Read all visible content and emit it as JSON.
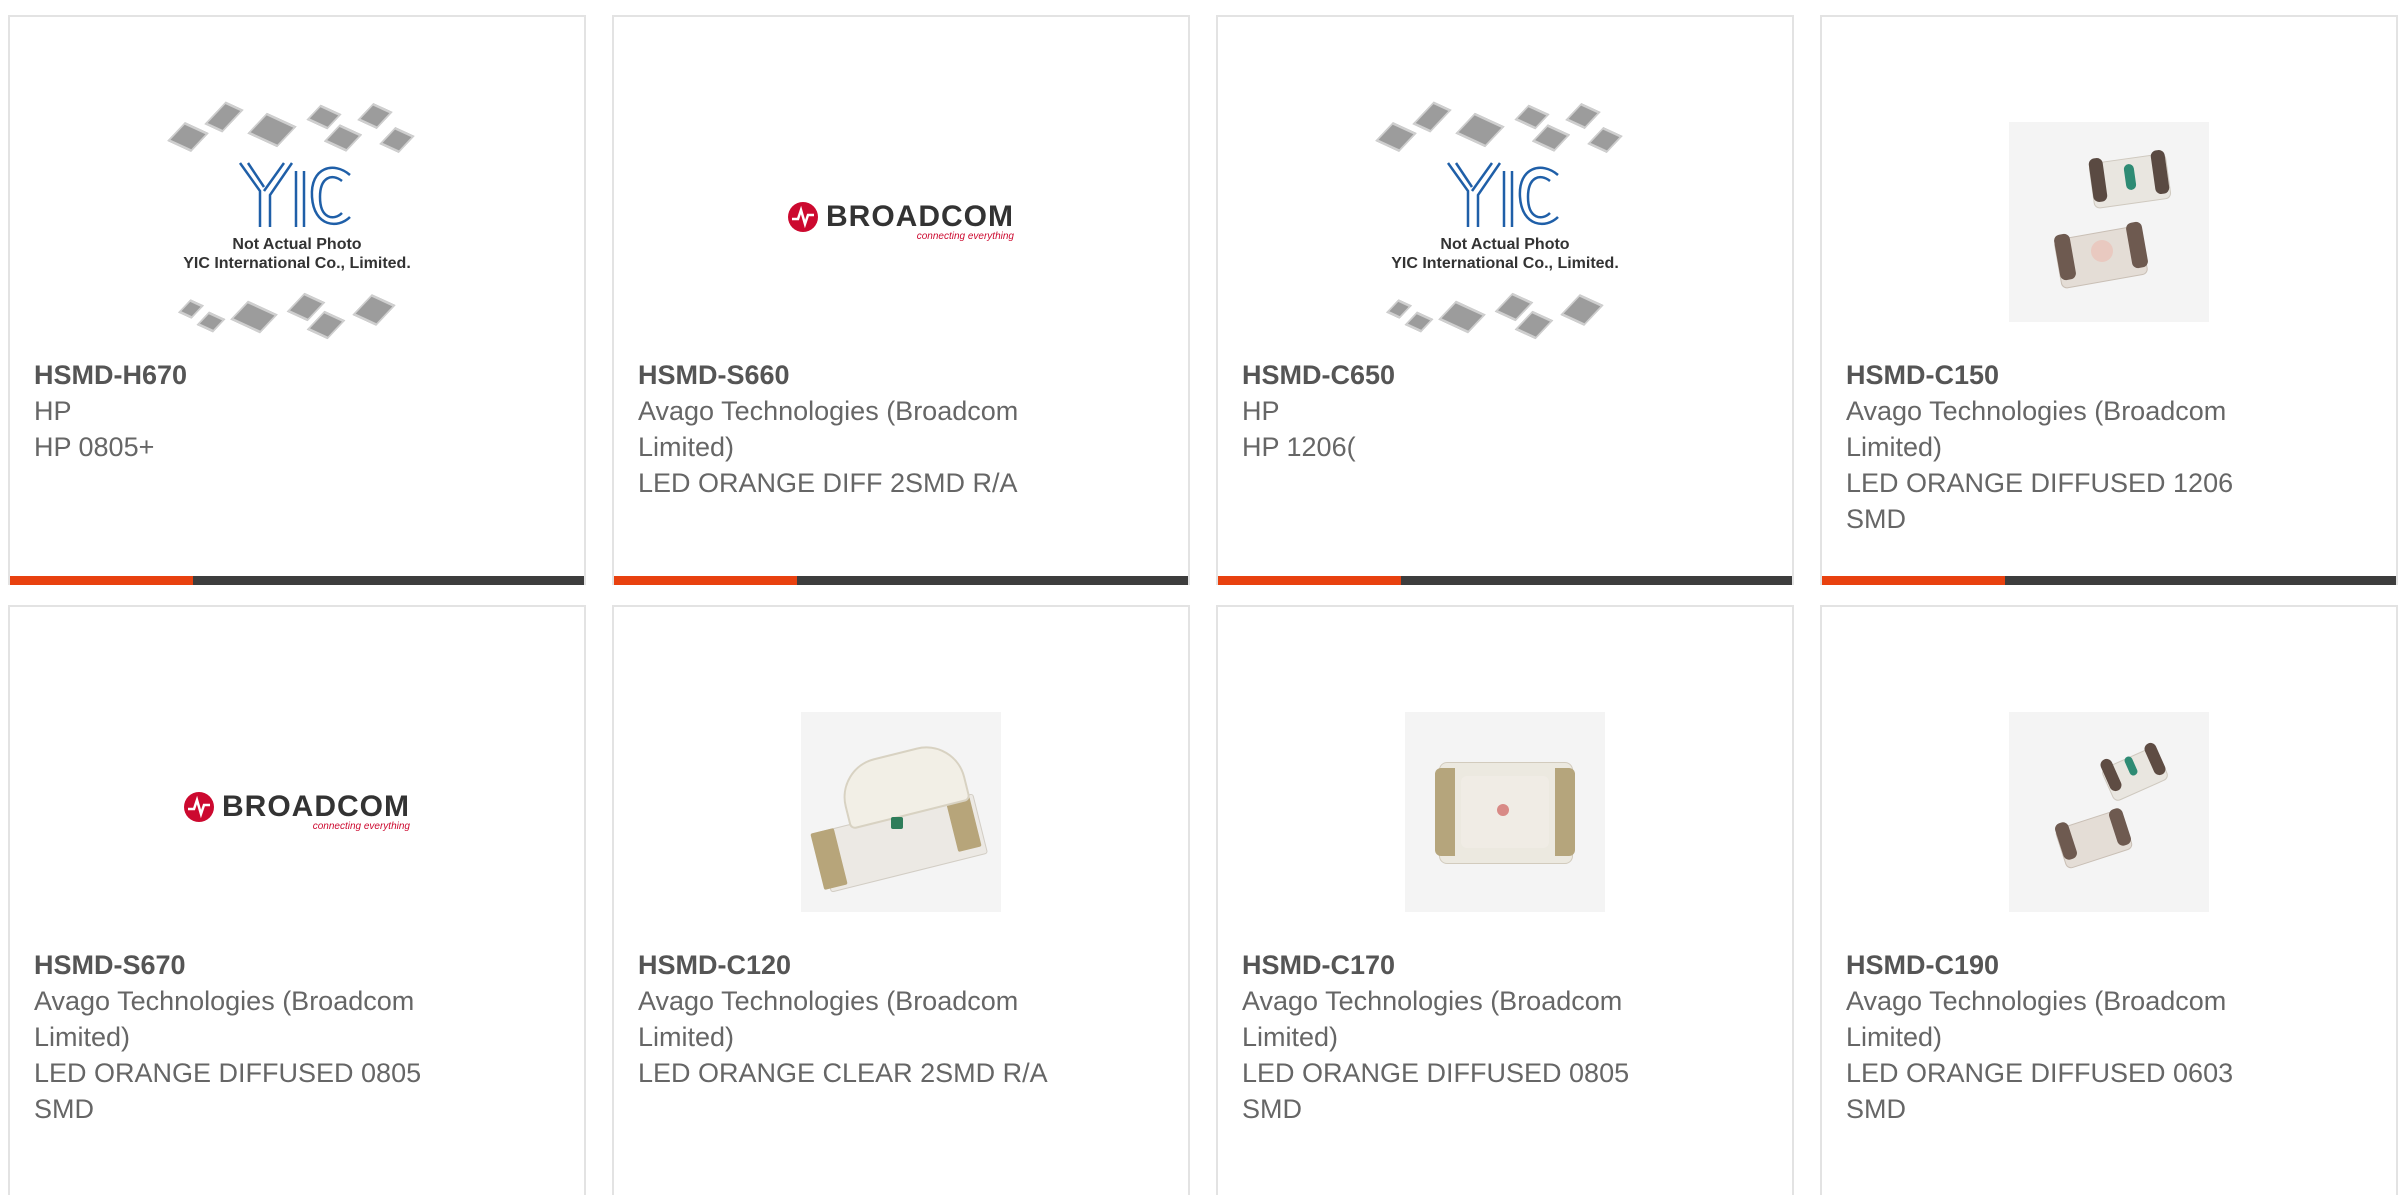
{
  "products": [
    {
      "part": "HSMD-H670",
      "manufacturer": "HP",
      "description": "HP 0805+",
      "image": "yic-placeholder",
      "placeholder_line1": "Not Actual Photo",
      "placeholder_line2": "YIC International Co., Limited."
    },
    {
      "part": "HSMD-S660",
      "manufacturer": "Avago Technologies (Broadcom Limited)",
      "description": "LED ORANGE DIFF 2SMD R/A",
      "image": "broadcom-logo",
      "logo_word": "BROADCOM",
      "logo_tag": "connecting everything"
    },
    {
      "part": "HSMD-C650",
      "manufacturer": "HP",
      "description": "HP 1206(",
      "image": "yic-placeholder",
      "placeholder_line1": "Not Actual Photo",
      "placeholder_line2": "YIC International Co., Limited."
    },
    {
      "part": "HSMD-C150",
      "manufacturer": "Avago Technologies (Broadcom Limited)",
      "description": "LED ORANGE DIFFUSED 1206 SMD",
      "image": "led-photo-pair"
    },
    {
      "part": "HSMD-S670",
      "manufacturer": "Avago Technologies (Broadcom Limited)",
      "description": "LED ORANGE DIFFUSED 0805 SMD",
      "image": "broadcom-logo",
      "logo_word": "BROADCOM",
      "logo_tag": "connecting everything"
    },
    {
      "part": "HSMD-C120",
      "manufacturer": "Avago Technologies (Broadcom Limited)",
      "description": "LED ORANGE CLEAR 2SMD R/A",
      "image": "led-photo-right-angle"
    },
    {
      "part": "HSMD-C170",
      "manufacturer": "Avago Technologies (Broadcom Limited)",
      "description": "LED ORANGE DIFFUSED 0805 SMD",
      "image": "led-photo-single"
    },
    {
      "part": "HSMD-C190",
      "manufacturer": "Avago Technologies (Broadcom Limited)",
      "description": "LED ORANGE DIFFUSED 0603 SMD",
      "image": "led-photo-pair"
    }
  ],
  "colors": {
    "accent": "#e8410f",
    "bar": "#3d3d3d",
    "broadcom_red": "#cc092f",
    "yic_blue": "#1f5fa8"
  }
}
